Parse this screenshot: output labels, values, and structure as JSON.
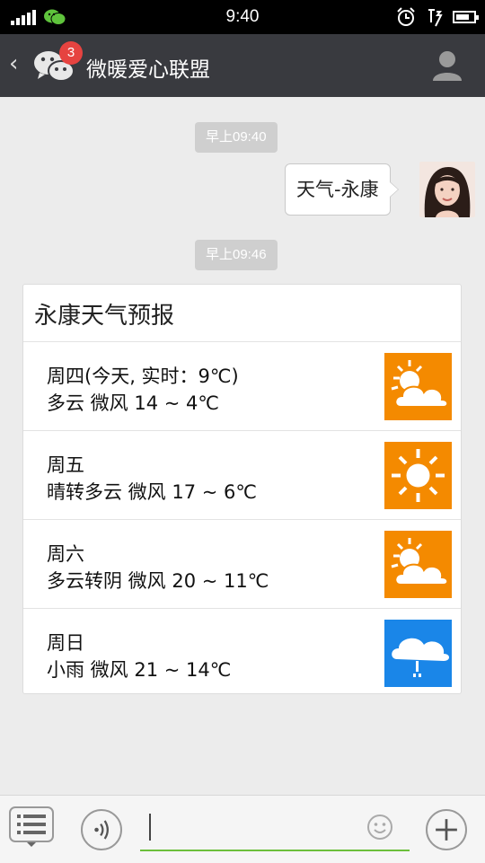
{
  "status_bar": {
    "time": "9:40"
  },
  "header": {
    "back_symbol": "‹",
    "unread_badge": "3",
    "title": "微暖爱心联盟"
  },
  "messages": [
    {
      "type": "timestamp",
      "text": "早上09:40"
    },
    {
      "type": "outgoing_text",
      "text": "天气-永康"
    },
    {
      "type": "timestamp",
      "text": "早上09:46"
    }
  ],
  "weather_card": {
    "title": "永康天气预报",
    "days": [
      {
        "line1": "周四(今天, 实时：9℃)",
        "line2": "多云 微风 14 ~ 4℃",
        "icon": "partly-cloudy-icon",
        "icon_bg": "#f48a00"
      },
      {
        "line1": "周五",
        "line2": "晴转多云 微风 17 ~ 6℃",
        "icon": "sunny-icon",
        "icon_bg": "#f48a00"
      },
      {
        "line1": "周六",
        "line2": "多云转阴 微风 20 ~ 11℃",
        "icon": "partly-cloudy-icon",
        "icon_bg": "#f48a00"
      },
      {
        "line1": "周日",
        "line2": "小雨 微风 21 ~ 14℃",
        "icon": "light-rain-icon",
        "icon_bg": "#1a86e8"
      }
    ]
  },
  "input_bar": {
    "input_value": ""
  },
  "colors": {
    "title_bar": "#393a3f",
    "chat_bg": "#ececec",
    "input_underline": "#6cbf3b",
    "badge": "#e64340",
    "sun_orange": "#f48a00",
    "rain_blue": "#1a86e8"
  }
}
